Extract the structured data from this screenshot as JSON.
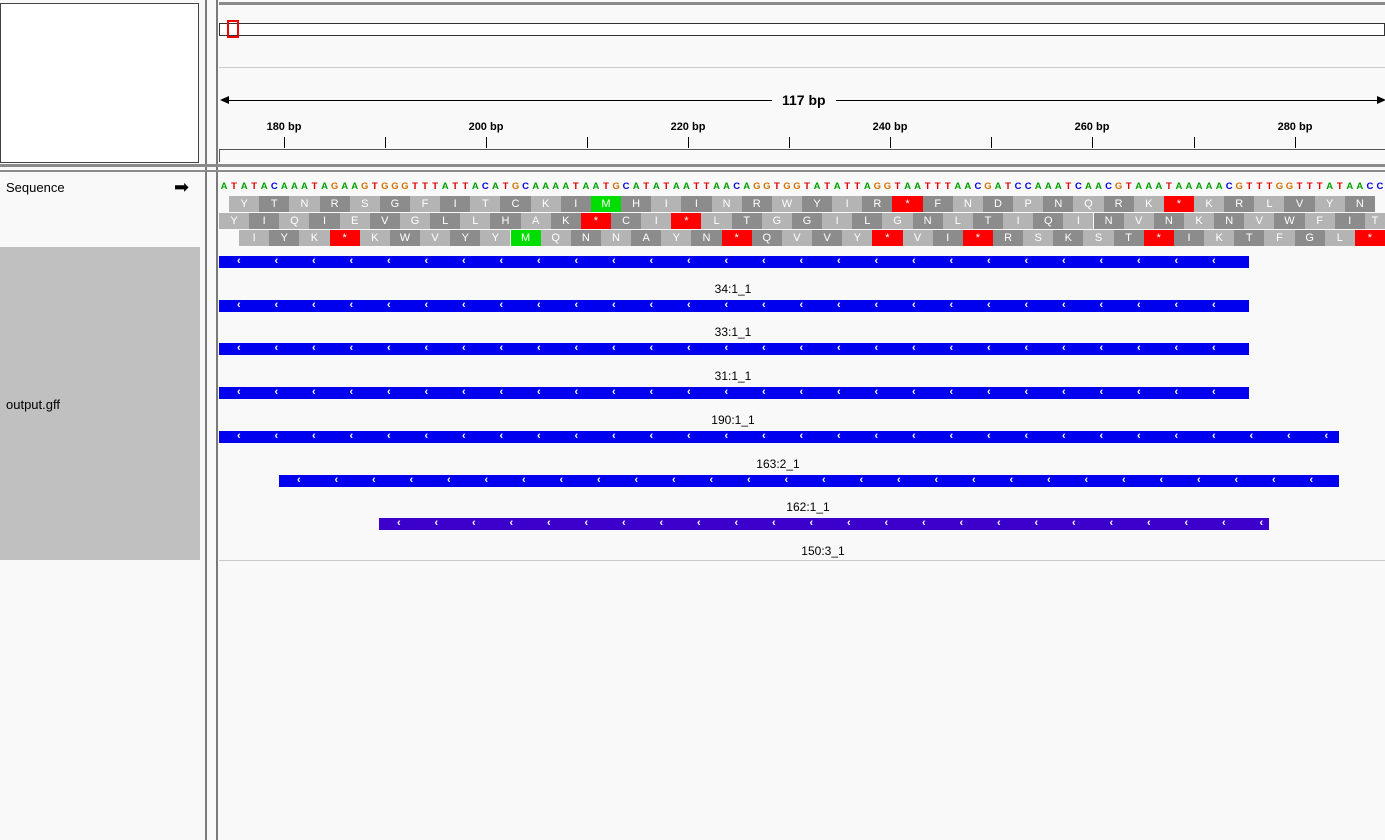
{
  "ruler": {
    "span_label": "117 bp",
    "ticks": [
      "180 bp",
      "200 bp",
      "220 bp",
      "240 bp",
      "260 bp",
      "280 bp"
    ]
  },
  "tracks": {
    "sequence_label": "Sequence",
    "strand_arrow_icon": "right-arrow-icon",
    "feature_track_label": "output.gff"
  },
  "sequence": "ATATACAAATAGAAGTGGGTTTATTACATGCAAAATAATGCATATAATTAACAGGTGGTATATTAGGTAATTTAACGATCCAAATCAACGTAAATAAAAACGTTTGGTTTATAACC",
  "translation": {
    "frame1": [
      "Y",
      "T",
      "N",
      "R",
      "S",
      "G",
      "F",
      "I",
      "T",
      "C",
      "K",
      "I",
      "M",
      "H",
      "I",
      "I",
      "N",
      "R",
      "W",
      "Y",
      "I",
      "R",
      "*",
      "F",
      "N",
      "D",
      "P",
      "N",
      "Q",
      "R",
      "K",
      "*",
      "K",
      "R",
      "L",
      "V",
      "Y",
      "N"
    ],
    "frame2": [
      "Y",
      "I",
      "Q",
      "I",
      "E",
      "V",
      "G",
      "L",
      "L",
      "H",
      "A",
      "K",
      "*",
      "C",
      "I",
      "*",
      "L",
      "T",
      "G",
      "G",
      "I",
      "L",
      "G",
      "N",
      "L",
      "T",
      "I",
      "Q",
      "I",
      "N",
      "V",
      "N",
      "K",
      "N",
      "V",
      "W",
      "F",
      "I",
      "T"
    ],
    "frame3": [
      "I",
      "Y",
      "K",
      "*",
      "K",
      "W",
      "V",
      "Y",
      "Y",
      "M",
      "Q",
      "N",
      "N",
      "A",
      "Y",
      "N",
      "*",
      "Q",
      "V",
      "V",
      "Y",
      "*",
      "V",
      "I",
      "*",
      "R",
      "S",
      "K",
      "S",
      "T",
      "*",
      "I",
      "K",
      "T",
      "F",
      "G",
      "L",
      "*",
      "R"
    ]
  },
  "features": [
    {
      "name": "34:1_1"
    },
    {
      "name": "33:1_1"
    },
    {
      "name": "31:1_1"
    },
    {
      "name": "190:1_1"
    },
    {
      "name": "163:2_1"
    },
    {
      "name": "162:1_1"
    },
    {
      "name": "150:3_1"
    }
  ],
  "colors": {
    "A": "#00a000",
    "C": "#0000e0",
    "G": "#d17105",
    "T": "#e00000",
    "stop": "#ff0000",
    "start": "#00dd00",
    "aa_light": "#b4b4b4",
    "aa_dark": "#8c8c8c",
    "feature": "#0000ee"
  }
}
